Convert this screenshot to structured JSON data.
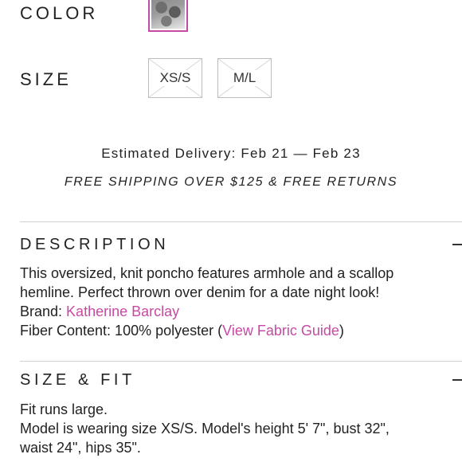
{
  "product": {
    "color_label": "COLOR",
    "size_label": "SIZE",
    "sizes": [
      "XS/S",
      "M/L"
    ]
  },
  "delivery": {
    "estimated_text": "Estimated Delivery: Feb 21 — Feb 23",
    "shipping_text": "FREE SHIPPING OVER $125 & FREE RETURNS"
  },
  "description": {
    "title": "DESCRIPTION",
    "toggle_symbol": "–",
    "line1": "This oversized, knit poncho features armhole and a scallop",
    "line2": "hemline. Perfect thrown over denim for a date night look!",
    "brand_prefix": "Brand: ",
    "brand_link": "Katherine Barclay",
    "fiber_prefix": "Fiber Content: 100% polyester (",
    "fabric_link": "View Fabric Guide",
    "fiber_suffix": ")"
  },
  "size_fit": {
    "title": "SIZE & FIT",
    "line1": "Fit runs large.",
    "line2": "Model is wearing size XS/S. Model's height 5' 7\", bust 32\",",
    "line3": "waist 24\", hips 35\"."
  },
  "colors": {
    "accent": "#c64aa4"
  }
}
